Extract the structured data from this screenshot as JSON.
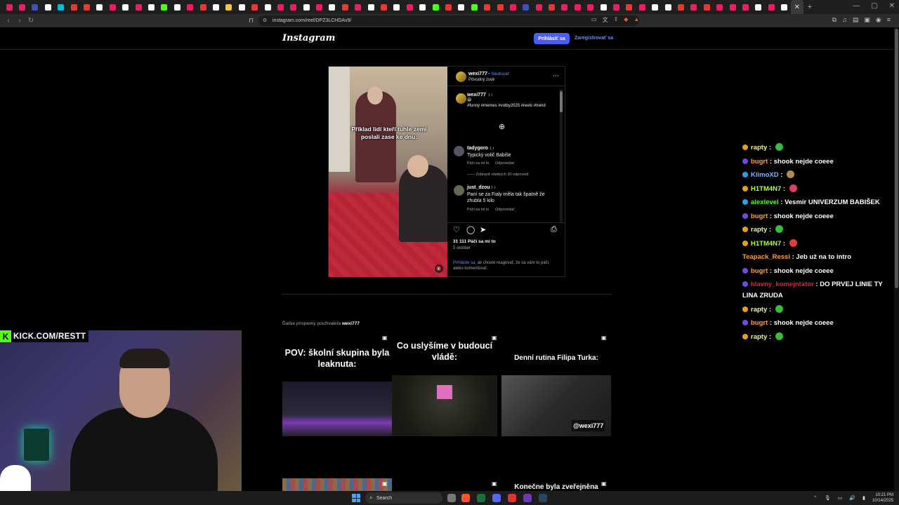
{
  "browser": {
    "tab_colors": [
      "#e91e63",
      "#e91e63",
      "#3f51b5",
      "#ffffff",
      "#00bcd4",
      "#e53935",
      "#e53935",
      "#ffffff",
      "#e91e63",
      "#ffffff",
      "#e91e63",
      "#ffffff",
      "#53fc18",
      "#ffffff",
      "#e91e63",
      "#e53935",
      "#ffffff",
      "#f5c542",
      "#ffffff",
      "#e53935",
      "#ffffff",
      "#e91e63",
      "#e91e63",
      "#ffffff",
      "#e91e63",
      "#ffffff",
      "#e53935",
      "#e91e63",
      "#ffffff",
      "#e53935",
      "#ffffff",
      "#e91e63",
      "#ffffff",
      "#53fc18",
      "#e53935",
      "#ffffff",
      "#53fc18",
      "#e53935",
      "#e53935",
      "#e91e63",
      "#3f51b5",
      "#e91e63",
      "#e53935",
      "#e91e63",
      "#e91e63",
      "#e91e63",
      "#ffffff",
      "#e91e63",
      "#e53935",
      "#e91e63",
      "#ffffff",
      "#ffffff",
      "#e53935",
      "#e91e63",
      "#e53935",
      "#e91e63",
      "#e91e63",
      "#e91e63",
      "#ffffff",
      "#e91e63",
      "#ffffff"
    ],
    "url": "instagram.com/reel/DPZ3LCHDAv9/"
  },
  "instagram": {
    "logo": "Instagram",
    "login_label": "Prihlásiť sa",
    "register_label": "Zaregistrovať sa",
    "post": {
      "video_caption": "Příklad lidí kteří tuhle zemi poslali zase ke dnu:",
      "author": "wexi777",
      "follow": "Sledovať",
      "sound": "Pôvodný zvuk",
      "caption_author": "wexi777",
      "caption_time": "1 t",
      "caption_emoji": "😆",
      "hashtags": "#funny #memes #volby2025 #reels #trend",
      "comments": [
        {
          "user": "tadygoro",
          "time": "1 t",
          "text": "Typický volič Babiše",
          "likes": "Páči sa mi to",
          "reply": "Odpovedať",
          "view_replies": "Zobraziť všetkých 30 odpovedí"
        },
        {
          "user": "just_dzou",
          "time": "1 t",
          "text": "Paní se za Fialy měla tak špatně že zhubla 5 kilo",
          "likes": "Páči sa mi to",
          "reply": "Odpovedať"
        }
      ],
      "like_count": "31 111 Páči sa mi to",
      "date": "5 október",
      "login_prompt_link": "Prihláste sa,",
      "login_prompt_rest": " ak chcete reagovať, že sa vám to páči, alebo komentovať."
    },
    "more_label_prefix": "Ďalšie príspevky používateľa ",
    "more_label_user": "wexi777",
    "thumbnails": [
      {
        "title": "POV: školní skupina byla leaknuta:"
      },
      {
        "title": "Co uslyšíme v budoucí vládě:"
      },
      {
        "title": "Denní rutina Filipa Turka:",
        "watermark": "@wexi777"
      },
      {
        "title": "Konečne byla zveřejněna"
      }
    ]
  },
  "stream": {
    "kick_logo": "K",
    "kick_text": "KICK.COM/RESTT"
  },
  "chat": [
    {
      "user": "rapty",
      "color": "#f5f5a0",
      "badge": "#e0a020",
      "msg": "",
      "emote": "#3cba3c"
    },
    {
      "user": "bugrt",
      "color": "#ff9c3c",
      "badge": "#6a4ce0",
      "msg": "shook nejde coeee",
      "emote": ""
    },
    {
      "user": "KlimoXD",
      "color": "#7fb3ff",
      "badge": "#2aa0e0",
      "msg": "",
      "emote": "#b58a5a"
    },
    {
      "user": "H1TM4N7",
      "color": "#b6ff3c",
      "badge": "#e0a020",
      "msg": "",
      "emote": "#e03c6a"
    },
    {
      "user": "alexlevel",
      "color": "#53fc18",
      "badge": "#2aa0e0",
      "msg": "Vesmír UNIVERZUM BABIŠEK",
      "emote": ""
    },
    {
      "user": "bugrt",
      "color": "#ff9c3c",
      "badge": "#6a4ce0",
      "msg": "shook nejde coeee",
      "emote": ""
    },
    {
      "user": "rapty",
      "color": "#f5f5a0",
      "badge": "#e0a020",
      "msg": "",
      "emote": "#3cba3c"
    },
    {
      "user": "H1TM4N7",
      "color": "#b6ff3c",
      "badge": "#e0a020",
      "msg": "",
      "emote": "#e03c3c"
    },
    {
      "user": "Teapack_Ressi",
      "color": "#ff9c3c",
      "badge": "",
      "msg": "Jeb už na to intro",
      "emote": ""
    },
    {
      "user": "bugrt",
      "color": "#ff9c3c",
      "badge": "#6a4ce0",
      "msg": "shook nejde coeee",
      "emote": ""
    },
    {
      "user": "hlavny_komejntator",
      "color": "#e0203c",
      "badge": "#6a4ce0",
      "msg": "DO PRVEJ LINIE TY LINA ZRUDA",
      "emote": ""
    },
    {
      "user": "rapty",
      "color": "#f5f5a0",
      "badge": "#e0a020",
      "msg": "",
      "emote": "#3cba3c"
    },
    {
      "user": "bugrt",
      "color": "#ff9c3c",
      "badge": "#6a4ce0",
      "msg": "shook nejde coeee",
      "emote": ""
    },
    {
      "user": "rapty",
      "color": "#f5f5a0",
      "badge": "#e0a020",
      "msg": "",
      "emote": "#3cba3c"
    }
  ],
  "taskbar": {
    "search_placeholder": "Search",
    "time": "10:21 PM",
    "date": "10/14/2025"
  }
}
